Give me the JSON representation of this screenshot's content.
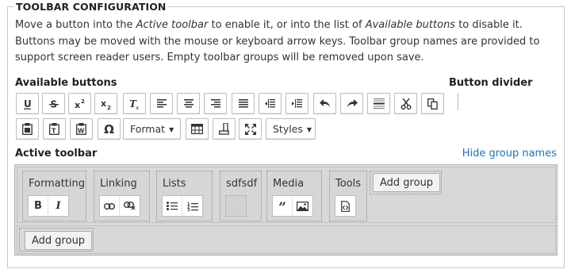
{
  "legend": "TOOLBAR CONFIGURATION",
  "description": {
    "p1": "Move a button into the ",
    "active_em": "Active toolbar",
    "p2": " to enable it, or into the list of ",
    "available_em": "Available buttons",
    "p3": " to disable it. Buttons may be moved with the mouse or keyboard arrow keys. Toolbar group names are provided to support screen reader users. Empty toolbar groups will be removed upon save."
  },
  "available": {
    "heading": "Available buttons",
    "row1": [
      "underline-icon",
      "strike-icon",
      "superscript-icon",
      "subscript-icon",
      "remove-format-icon",
      "align-left-icon",
      "align-center-icon",
      "align-right-icon",
      "align-justify-icon",
      "outdent-icon",
      "indent-icon",
      "undo-icon",
      "redo-icon",
      "horizontal-rule-icon",
      "cut-icon",
      "copy-icon"
    ],
    "row2_icons": [
      "paste-icon",
      "paste-text-icon",
      "paste-word-icon",
      "special-char-icon"
    ],
    "format_label": "Format",
    "styles_label": "Styles",
    "omega": "Ω"
  },
  "divider": {
    "heading": "Button divider"
  },
  "active": {
    "heading": "Active toolbar",
    "hide_link": "Hide group names",
    "groups": [
      {
        "label": "Formatting",
        "buttons": [
          "B",
          "I"
        ]
      },
      {
        "label": "Linking",
        "buttons": [
          "link-icon",
          "unlink-icon"
        ]
      },
      {
        "label": "Lists",
        "buttons": [
          "bullet-list-icon",
          "numbered-list-icon"
        ]
      },
      {
        "label": "sdfsdf",
        "buttons": []
      },
      {
        "label": "Media",
        "buttons": [
          "blockquote-icon",
          "image-icon"
        ]
      },
      {
        "label": "Tools",
        "buttons": [
          "source-icon"
        ]
      }
    ],
    "add_group_label": "Add group"
  }
}
